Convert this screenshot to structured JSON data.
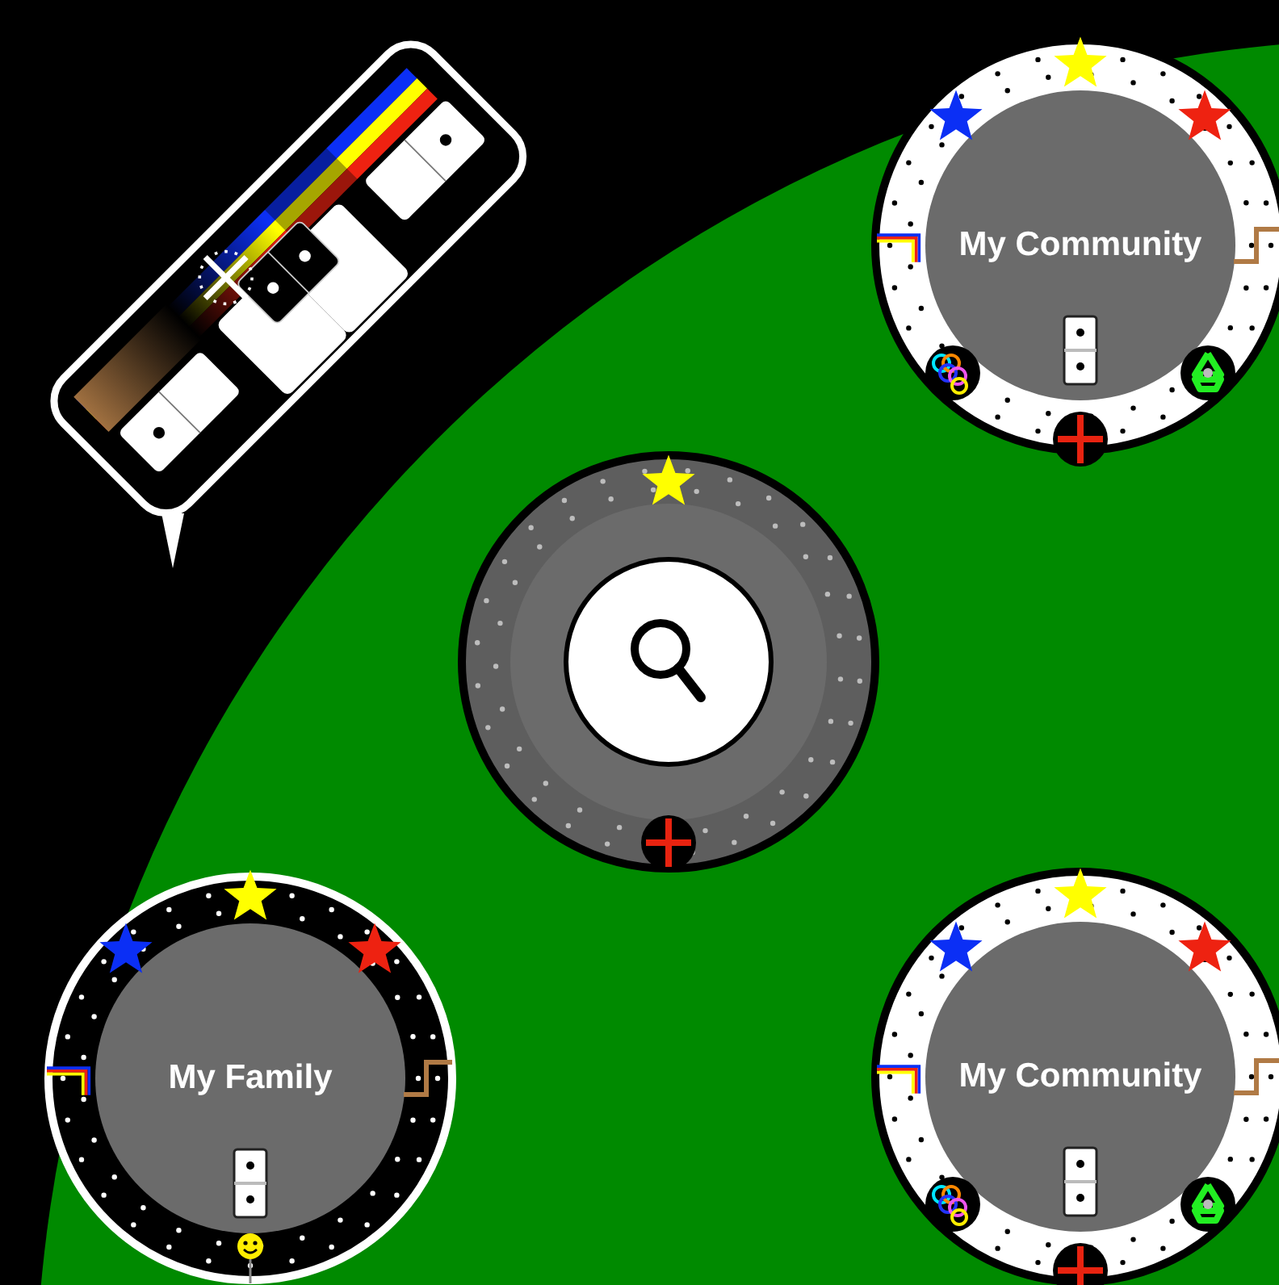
{
  "groups": [
    {
      "kind": "community",
      "label": "My Community"
    },
    {
      "kind": "search"
    },
    {
      "kind": "family",
      "label": "My Family"
    },
    {
      "kind": "community",
      "label": "My Community"
    }
  ]
}
